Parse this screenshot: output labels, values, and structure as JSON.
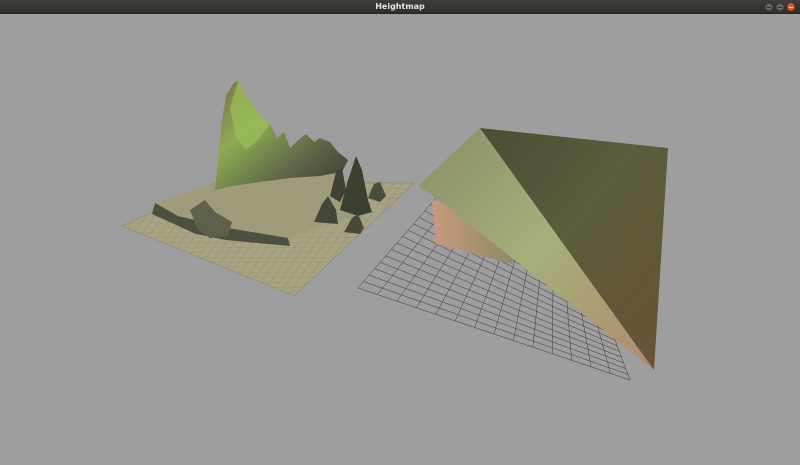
{
  "window": {
    "title": "Heightmap",
    "controls": [
      "minimize-icon",
      "maximize-icon",
      "close-icon"
    ]
  },
  "colors": {
    "background": "#9e9e9e",
    "titlebar": "#353431",
    "close_button": "#e15a2c"
  }
}
